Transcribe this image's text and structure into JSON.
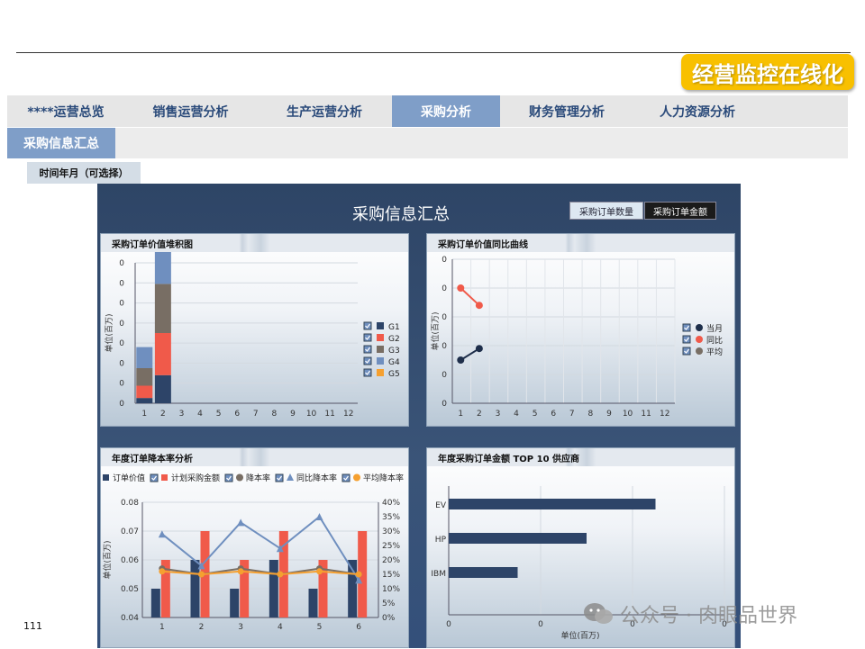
{
  "brand": "经营监控在线化",
  "tabs": [
    "****运营总览",
    "销售运营分析",
    "生产运营分析",
    "采购分析",
    "财务管理分析",
    "人力资源分析"
  ],
  "active_tab": 3,
  "subtab": "采购信息汇总",
  "filter_label": "时间年月（可选择）",
  "dashboard": {
    "title": "采购信息汇总",
    "toggle_count": "采购订单数量",
    "toggle_amount": "采购订单金额"
  },
  "page_number": "111",
  "watermark": "公众号 · 肉眼品世界",
  "colors": {
    "navy": "#2d4468",
    "red": "#f05a4a",
    "gray": "#786e64",
    "steel": "#6f8fbf",
    "orange": "#f5a030",
    "tab_active": "#7f9ec8",
    "badge": "#f8c000"
  },
  "chart_data": [
    {
      "type": "bar",
      "title": "采购订单价值堆积图",
      "ylabel": "单位(百万)",
      "categories": [
        "1",
        "2",
        "3",
        "4",
        "5",
        "6",
        "7",
        "8",
        "9",
        "10",
        "11",
        "12"
      ],
      "y_ticks": [
        "0",
        "0",
        "0",
        "0",
        "0",
        "0",
        "0",
        "0"
      ],
      "stacked": true,
      "ylim": [
        0,
        8
      ],
      "series": [
        {
          "name": "G1",
          "color": "#2d4468",
          "values": [
            0.3,
            1.6,
            0,
            0,
            0,
            0,
            0,
            0,
            0,
            0,
            0,
            0
          ]
        },
        {
          "name": "G2",
          "color": "#f05a4a",
          "values": [
            0.7,
            2.4,
            0,
            0,
            0,
            0,
            0,
            0,
            0,
            0,
            0,
            0
          ]
        },
        {
          "name": "G3",
          "color": "#786e64",
          "values": [
            1.0,
            2.8,
            0,
            0,
            0,
            0,
            0,
            0,
            0,
            0,
            0,
            0
          ]
        },
        {
          "name": "G4",
          "color": "#6f8fbf",
          "values": [
            1.2,
            3.2,
            0,
            0,
            0,
            0,
            0,
            0,
            0,
            0,
            0,
            0
          ]
        },
        {
          "name": "G5",
          "color": "#f5a030",
          "values": [
            0,
            0,
            0,
            0,
            0,
            0,
            0,
            0,
            0,
            0,
            0,
            0
          ]
        }
      ]
    },
    {
      "type": "line",
      "title": "采购订单价值同比曲线",
      "ylabel": "单位(百万)",
      "categories": [
        "1",
        "2",
        "3",
        "4",
        "5",
        "6",
        "7",
        "8",
        "9",
        "10",
        "11",
        "12"
      ],
      "y_ticks": [
        "0",
        "0",
        "0",
        "0",
        "0",
        "0"
      ],
      "ylim": [
        0,
        5
      ],
      "series": [
        {
          "name": "当月",
          "color": "#1e2e4a",
          "values": [
            1.5,
            1.9
          ]
        },
        {
          "name": "同比",
          "color": "#f05a4a",
          "values": [
            4.0,
            3.4
          ]
        },
        {
          "name": "平均",
          "color": "#786e64",
          "values": []
        }
      ]
    },
    {
      "type": "bar",
      "title": "年度订单降本率分析",
      "ylabel": "单位(百万)",
      "categories": [
        "1",
        "2",
        "3",
        "4",
        "5",
        "6"
      ],
      "y_ticks": [
        "0.04",
        "0.05",
        "0.06",
        "0.07",
        "0.08"
      ],
      "y2_ticks": [
        "0%",
        "5%",
        "10%",
        "15%",
        "20%",
        "25%",
        "30%",
        "35%",
        "40%"
      ],
      "ylim": [
        0.04,
        0.08
      ],
      "y2lim": [
        0,
        40
      ],
      "series": [
        {
          "name": "订单价值",
          "color": "#2d4468",
          "kind": "bar",
          "values": [
            0.05,
            0.06,
            0.05,
            0.06,
            0.05,
            0.06
          ]
        },
        {
          "name": "计划采购金额",
          "color": "#f05a4a",
          "kind": "bar",
          "values": [
            0.06,
            0.07,
            0.06,
            0.07,
            0.06,
            0.07
          ]
        },
        {
          "name": "降本率",
          "color": "#786e64",
          "kind": "line",
          "axis": "right",
          "values": [
            17,
            15,
            17,
            15,
            17,
            15
          ]
        },
        {
          "name": "同比降本率",
          "color": "#6f8fbf",
          "kind": "line",
          "axis": "right",
          "values": [
            29,
            18,
            33,
            24,
            35,
            13
          ]
        },
        {
          "name": "平均降本率",
          "color": "#f5a030",
          "kind": "line",
          "axis": "right",
          "values": [
            16,
            15,
            16,
            15,
            16,
            15
          ]
        }
      ]
    },
    {
      "type": "bar",
      "orientation": "horizontal",
      "title": "年度采购订单金额 TOP 10 供应商",
      "xlabel": "单位(百万)",
      "categories": [
        "EV",
        "HP",
        "IBM"
      ],
      "x_ticks": [
        "0",
        "0",
        "0",
        "0"
      ],
      "xlim": [
        0,
        4
      ],
      "values": [
        3.0,
        2.0,
        1.0
      ],
      "color": "#2d4468"
    }
  ]
}
